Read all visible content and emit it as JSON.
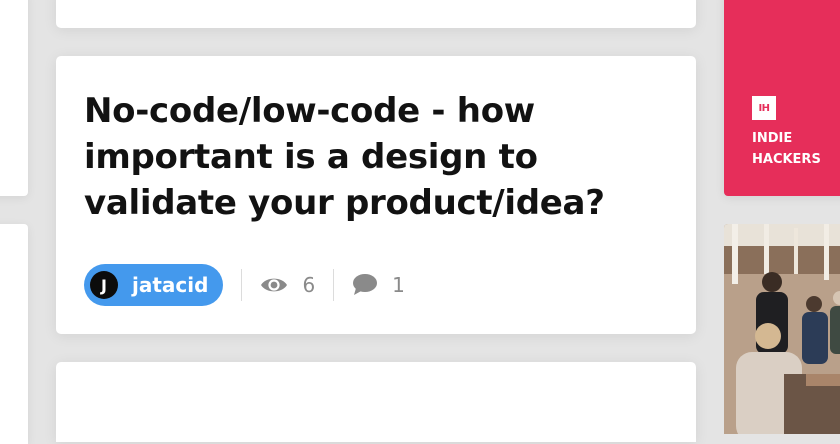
{
  "post": {
    "title": "No-code/low-code - how important is a design to validate your product/idea?",
    "author": {
      "name": "jatacid",
      "avatar_initial": "J"
    },
    "stats": {
      "views": "6",
      "comments": "1"
    }
  },
  "sidebar": {
    "brand_logo": "IH",
    "brand_text": "INDIE HACKERS",
    "brand_color": "#e62e5a"
  },
  "colors": {
    "author_pill": "#4499ed",
    "title": "#121212",
    "meta": "#8a8a8a"
  },
  "icons": {
    "views": "eye-icon",
    "comments": "speech-bubble-icon"
  }
}
